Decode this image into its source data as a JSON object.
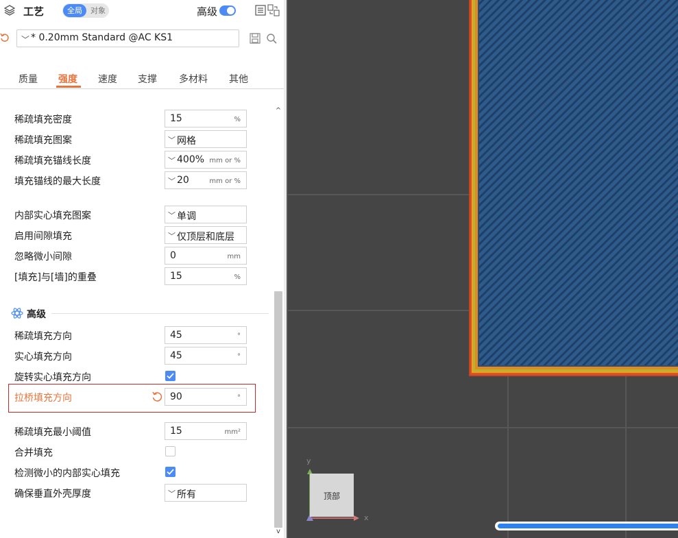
{
  "header": {
    "title": "工艺",
    "scope_global": "全局",
    "scope_object": "对象",
    "advanced_label": "高级",
    "advanced_toggle_on": true
  },
  "profile": {
    "preset_name": "* 0.20mm Standard @AC KS1"
  },
  "tabs": [
    {
      "label": "质量",
      "active": false
    },
    {
      "label": "强度",
      "active": true
    },
    {
      "label": "速度",
      "active": false
    },
    {
      "label": "支撑",
      "active": false
    },
    {
      "label": "多材料",
      "active": false
    },
    {
      "label": "其他",
      "active": false
    }
  ],
  "settings": {
    "sparse_infill_density": {
      "label": "稀疏填充密度",
      "value": "15",
      "unit": "%"
    },
    "sparse_infill_pattern": {
      "label": "稀疏填充图案",
      "value": "网格"
    },
    "sparse_infill_anchor": {
      "label": "稀疏填充锚线长度",
      "value": "400%",
      "unit": "mm or %"
    },
    "infill_anchor_max": {
      "label": "填充锚线的最大长度",
      "value": "20",
      "unit": "mm or %"
    },
    "internal_solid_pattern": {
      "label": "内部实心填充图案",
      "value": "单调"
    },
    "gap_fill": {
      "label": "启用间隙填充",
      "value": "仅顶层和底层"
    },
    "filter_small_gaps": {
      "label": "忽略微小间隙",
      "value": "0",
      "unit": "mm"
    },
    "infill_wall_overlap": {
      "label": "[填充]与[墙]的重叠",
      "value": "15",
      "unit": "%"
    }
  },
  "advanced_section": {
    "title": "高级",
    "sparse_infill_direction": {
      "label": "稀疏填充方向",
      "value": "45",
      "unit": "°"
    },
    "solid_infill_direction": {
      "label": "实心填充方向",
      "value": "45",
      "unit": "°"
    },
    "rotate_solid_infill": {
      "label": "旋转实心填充方向",
      "checked": true
    },
    "bridge_infill_direction": {
      "label": "拉桥填充方向",
      "value": "90",
      "unit": "°"
    },
    "minimum_sparse_infill_threshold": {
      "label": "稀疏填充最小阈值",
      "value": "15",
      "unit": "mm²"
    },
    "merge_infill": {
      "label": "合并填充",
      "checked": false
    },
    "detect_narrow_internal_solid": {
      "label": "检测微小的内部实心填充",
      "checked": true
    },
    "ensure_vertical_shell": {
      "label": "确保垂直外壳厚度",
      "value": "所有"
    }
  },
  "viewport": {
    "view_cube_label": "顶部",
    "axis_x": "x",
    "axis_y": "y",
    "progress": 1.0
  },
  "colors": {
    "accent": "#4c8bf5",
    "warning": "#e8743b",
    "highlight_border": "#c62828",
    "infill_blue": "#2e5d8f",
    "viewport_bg": "#454545"
  }
}
